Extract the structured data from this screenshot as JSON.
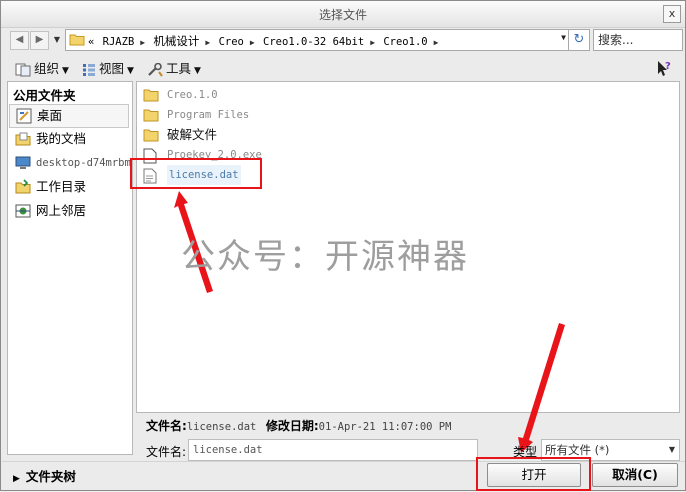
{
  "window": {
    "title": "选择文件",
    "close": "x"
  },
  "nav": {
    "back": "◀",
    "forward": "▶",
    "dropdown": "▼"
  },
  "address": {
    "crumbs": [
      "«",
      "RJAZB",
      "机械设计",
      "Creo",
      "Creo1.0-32 64bit",
      "Creo1.0"
    ],
    "refresh": "↻"
  },
  "search": {
    "placeholder": "搜索..."
  },
  "toolbar": {
    "organize": "组织",
    "views": "视图",
    "tools": "工具"
  },
  "sidebar": {
    "heading": "公用文件夹",
    "items": [
      {
        "label": "桌面",
        "icon": "desktop-icon",
        "selected": true
      },
      {
        "label": "我的文档",
        "icon": "documents-icon"
      },
      {
        "label": "desktop-d74mrbm",
        "icon": "computer-icon"
      },
      {
        "label": "工作目录",
        "icon": "work-folder-icon"
      },
      {
        "label": "网上邻居",
        "icon": "network-icon"
      }
    ]
  },
  "files": [
    {
      "name": "Creo.1.0",
      "type": "folder"
    },
    {
      "name": "Program Files",
      "type": "folder"
    },
    {
      "name": "破解文件",
      "type": "folder"
    },
    {
      "name": "Proekey_2.0.exe",
      "type": "file"
    },
    {
      "name": "license.dat",
      "type": "file",
      "highlighted": true
    }
  ],
  "watermark": "公众号：开源神器",
  "details": {
    "name_label": "文件名:",
    "name_value": "license.dat",
    "modified_label": "修改日期:",
    "modified_value": "01-Apr-21 11:07:00 PM"
  },
  "filename": {
    "label": "文件名:",
    "value": "license.dat"
  },
  "filetype": {
    "label": "类型",
    "value": "所有文件 (*)"
  },
  "footer": {
    "folder_tree": "文件夹树",
    "open": "打开",
    "cancel": "取消(C)"
  },
  "colors": {
    "annotation_red": "#e8141a",
    "selection_text": "#4a7aa8"
  }
}
